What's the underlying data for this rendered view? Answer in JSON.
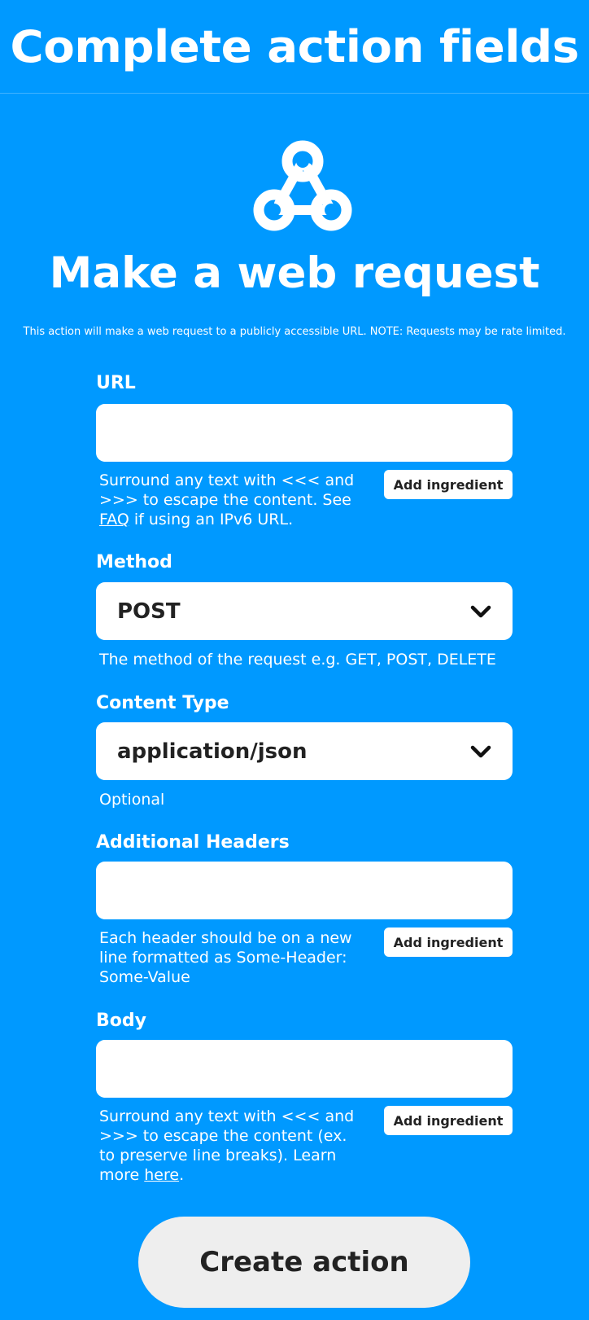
{
  "header": {
    "title": "Complete action fields"
  },
  "service": {
    "icon": "webhook-icon",
    "action_title": "Make a web request",
    "description": "This action will make a web request to a publicly accessible URL. NOTE: Requests may be rate limited."
  },
  "fields": {
    "url": {
      "label": "URL",
      "value": "",
      "help_1": "Surround any text with <<< and >>> to escape the content. See ",
      "help_link": "FAQ",
      "help_2": " if using an IPv6 URL.",
      "ingredient_label": "Add ingredient"
    },
    "method": {
      "label": "Method",
      "value": "POST",
      "help": "The method of the request e.g. GET, POST, DELETE"
    },
    "content_type": {
      "label": "Content Type",
      "value": "application/json",
      "help": "Optional"
    },
    "additional_headers": {
      "label": "Additional Headers",
      "value": "",
      "help": "Each header should be on a new line formatted as Some-Header: Some-Value",
      "ingredient_label": "Add ingredient"
    },
    "body": {
      "label": "Body",
      "value": "",
      "help_1": "Surround any text with <<< and >>> to escape the content (ex. to preserve line breaks). Learn more ",
      "help_link": "here",
      "help_2": ".",
      "ingredient_label": "Add ingredient"
    }
  },
  "submit": {
    "label": "Create action"
  },
  "colors": {
    "background": "#0099ff",
    "input_background": "#ffffff",
    "button_background": "#eeeeee",
    "text_dark": "#222222"
  }
}
